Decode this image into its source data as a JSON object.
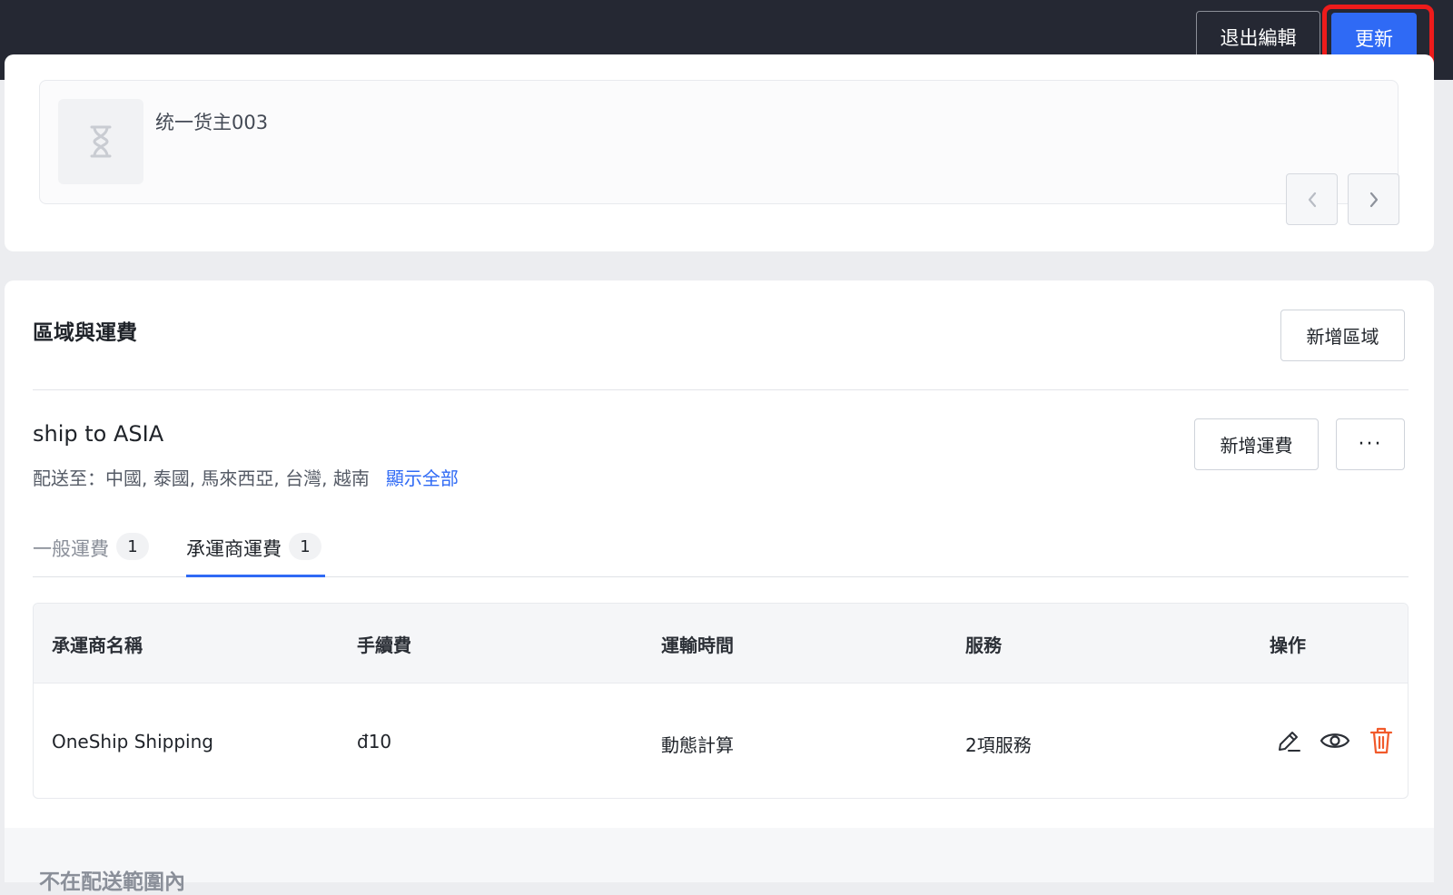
{
  "header": {
    "exit_edit_label": "退出編輯",
    "update_label": "更新"
  },
  "merchant": {
    "name": "统一货主003",
    "thumb_icon": "hourglass-icon"
  },
  "pagination": {
    "prev_icon": "chevron-left-icon",
    "next_icon": "chevron-right-icon"
  },
  "zones_section": {
    "title": "區域與運費",
    "add_zone_label": "新增區域"
  },
  "zone": {
    "name": "ship to ASIA",
    "destinations": "配送至：中國, 泰國, 馬來西亞, 台灣, 越南",
    "show_all_label": "顯示全部",
    "add_rate_label": "新增運費",
    "more_label": "···"
  },
  "tabs": [
    {
      "label": "一般運費",
      "count": "1",
      "active": false
    },
    {
      "label": "承運商運費",
      "count": "1",
      "active": true
    }
  ],
  "table": {
    "headers": [
      "承運商名稱",
      "手續費",
      "運輸時間",
      "服務",
      "操作"
    ],
    "rows": [
      {
        "carrier": "OneShip Shipping",
        "fee": "đ10",
        "transit": "動態計算",
        "services": "2項服務"
      }
    ]
  },
  "footer": {
    "title": "不在配送範圍內"
  },
  "colors": {
    "primary": "#2f6af5",
    "danger": "#f15a2b",
    "topbar": "#252833",
    "highlight": "#ee1b1b"
  }
}
